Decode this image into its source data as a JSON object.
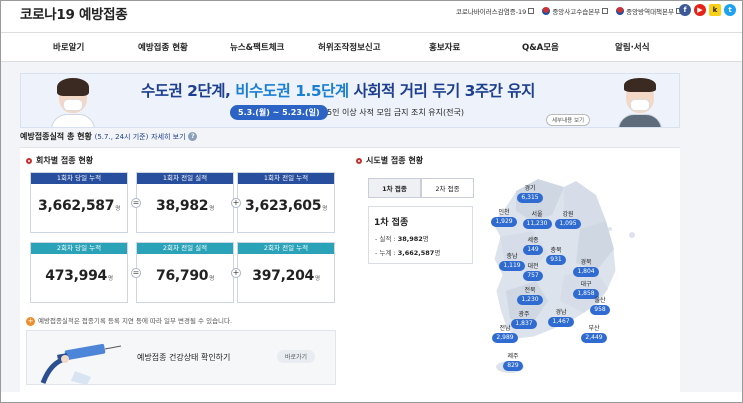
{
  "header": {
    "logo": "코로나19 예방접종",
    "links": [
      "코로나바이러스감염증-19",
      "중앙사고수습본부",
      "중앙방역대책본부"
    ],
    "sns": [
      {
        "name": "facebook-icon",
        "glyph": "f"
      },
      {
        "name": "youtube-icon",
        "glyph": "▶"
      },
      {
        "name": "kakao-icon",
        "glyph": "k"
      },
      {
        "name": "twitter-icon",
        "glyph": "t"
      }
    ]
  },
  "nav": [
    "바로알기",
    "예방접종 현황",
    "뉴스&팩트체크",
    "허위조작정보신고",
    "홍보자료",
    "Q&A모음",
    "알림·서식"
  ],
  "banner": {
    "headline_a": "수도권 2단계, ",
    "headline_b": "비수도권 1.5단계",
    "headline_c": " 사회적 거리 두기 3주간 유지",
    "dates": "5.3.(월) ~ 5.23.(일)",
    "sub": "5인 이상 사적 모임 금지 조치 유지(전국)",
    "detail": "세부내용 보기"
  },
  "summary": {
    "title": "예방접종실적 총 현황",
    "date": "(5.7., 24시 기준)",
    "more": "자세히 보기",
    "help": "?"
  },
  "dose_section": {
    "title": "회차별 접종 현황",
    "unit": "명",
    "first": [
      {
        "label": "1회차 당일 누적",
        "value": "3,662,587"
      },
      {
        "label": "1회차 전일 실적",
        "value": "38,982"
      },
      {
        "label": "1회차 전일 누적",
        "value": "3,623,605"
      }
    ],
    "second": [
      {
        "label": "2회차 당일 누적",
        "value": "473,994"
      },
      {
        "label": "2회차 전일 실적",
        "value": "76,790"
      },
      {
        "label": "2회차 전일 누적",
        "value": "397,204"
      }
    ],
    "ops": [
      "=",
      "+"
    ]
  },
  "notice": "예방접종실적은 접종기록 등록 지연 등에 따라 일부 변경될 수 있습니다.",
  "health": {
    "label": "예방접종 건강상태 확인하기",
    "go": "바로가기"
  },
  "region_section": {
    "title": "시도별 접종 현황",
    "tabs": [
      "1차 접종",
      "2차 접종"
    ],
    "box_title": "1차 접종",
    "perf_label": "- 실적 : ",
    "perf_value": "38,982",
    "cum_label": "- 누계 : ",
    "cum_value": "3,662,587",
    "unit": "명",
    "regions": [
      {
        "name": "경기",
        "value": "6,315"
      },
      {
        "name": "인천",
        "value": "1,929"
      },
      {
        "name": "서울",
        "value": "11,230"
      },
      {
        "name": "강원",
        "value": "1,095"
      },
      {
        "name": "세종",
        "value": "149"
      },
      {
        "name": "충북",
        "value": "931"
      },
      {
        "name": "충남",
        "value": "1,119"
      },
      {
        "name": "대전",
        "value": "757"
      },
      {
        "name": "경북",
        "value": "1,804"
      },
      {
        "name": "대구",
        "value": "1,858"
      },
      {
        "name": "전북",
        "value": "1,230"
      },
      {
        "name": "울산",
        "value": "958"
      },
      {
        "name": "광주",
        "value": "1,837"
      },
      {
        "name": "경남",
        "value": "1,467"
      },
      {
        "name": "부산",
        "value": "2,449"
      },
      {
        "name": "전남",
        "value": "2,989"
      },
      {
        "name": "제주",
        "value": "829"
      }
    ]
  },
  "colors": {
    "navy": "#284e9e",
    "teal": "#2aa3b8",
    "pin": "#2f6bd0",
    "accent": "#c7302f"
  }
}
